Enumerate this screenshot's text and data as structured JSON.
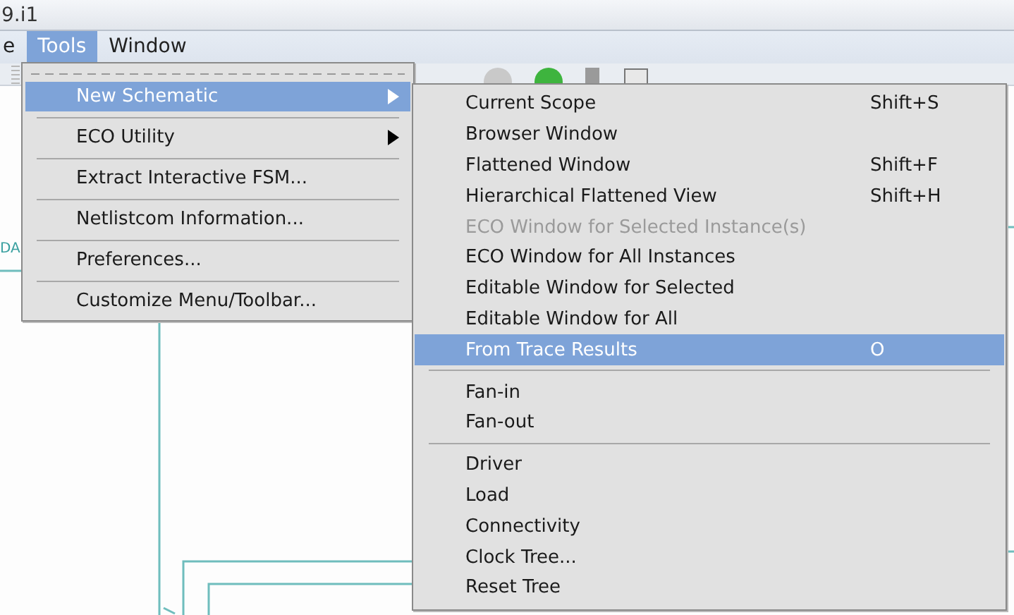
{
  "window": {
    "title": "9.i1"
  },
  "menubar": [
    {
      "label": "e",
      "selected": false
    },
    {
      "label": "Tools",
      "selected": true
    },
    {
      "label": "Window",
      "selected": false
    }
  ],
  "canvas": {
    "net_label": "DA"
  },
  "tools_menu": {
    "tear_off": true,
    "items": [
      {
        "kind": "item",
        "label": "New Schematic",
        "submenu": true,
        "selected": true
      },
      {
        "kind": "separator"
      },
      {
        "kind": "item",
        "label": "ECO Utility",
        "submenu": true,
        "selected": false
      },
      {
        "kind": "separator"
      },
      {
        "kind": "item",
        "label": "Extract Interactive FSM...",
        "submenu": false,
        "selected": false
      },
      {
        "kind": "separator"
      },
      {
        "kind": "item",
        "label": "Netlistcom Information...",
        "submenu": false,
        "selected": false
      },
      {
        "kind": "separator"
      },
      {
        "kind": "item",
        "label": "Preferences...",
        "submenu": false,
        "selected": false
      },
      {
        "kind": "separator"
      },
      {
        "kind": "item",
        "label": "Customize Menu/Toolbar...",
        "submenu": false,
        "selected": false
      }
    ]
  },
  "submenu": {
    "items": [
      {
        "kind": "item",
        "label": "Current Scope",
        "shortcut": "Shift+S",
        "disabled": false,
        "selected": false
      },
      {
        "kind": "item",
        "label": "Browser Window",
        "disabled": false,
        "selected": false
      },
      {
        "kind": "item",
        "label": "Flattened Window",
        "shortcut": "Shift+F",
        "disabled": false,
        "selected": false
      },
      {
        "kind": "item",
        "label": "Hierarchical Flattened View",
        "shortcut": "Shift+H",
        "disabled": false,
        "selected": false
      },
      {
        "kind": "item",
        "label": "ECO Window for Selected Instance(s)",
        "disabled": true,
        "selected": false
      },
      {
        "kind": "item",
        "label": "ECO Window for All Instances",
        "disabled": false,
        "selected": false
      },
      {
        "kind": "item",
        "label": "Editable Window for Selected",
        "disabled": false,
        "selected": false
      },
      {
        "kind": "item",
        "label": "Editable Window for All",
        "disabled": false,
        "selected": false
      },
      {
        "kind": "item",
        "label": "From Trace Results",
        "shortcut": "O",
        "disabled": false,
        "selected": true
      },
      {
        "kind": "separator"
      },
      {
        "kind": "item",
        "label": "Fan-in",
        "disabled": false,
        "selected": false
      },
      {
        "kind": "item",
        "label": "Fan-out",
        "disabled": false,
        "selected": false
      },
      {
        "kind": "separator"
      },
      {
        "kind": "item",
        "label": "Driver",
        "disabled": false,
        "selected": false
      },
      {
        "kind": "item",
        "label": "Load",
        "disabled": false,
        "selected": false
      },
      {
        "kind": "item",
        "label": "Connectivity",
        "disabled": false,
        "selected": false
      },
      {
        "kind": "item",
        "label": "Clock Tree...",
        "disabled": false,
        "selected": false
      },
      {
        "kind": "item",
        "label": "Reset Tree",
        "disabled": false,
        "selected": false
      }
    ]
  }
}
